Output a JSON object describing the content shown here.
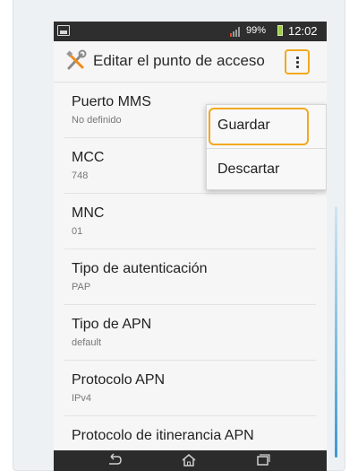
{
  "status_bar": {
    "battery_percent": "99%",
    "time": "12:02",
    "icons": [
      "picture-notification-icon",
      "signal-icon",
      "battery-icon"
    ]
  },
  "action_bar": {
    "title": "Editar el punto de acceso",
    "icon": "tools-icon",
    "overflow_icon": "more-vert-icon"
  },
  "settings": [
    {
      "title": "Puerto MMS",
      "value": "No definido"
    },
    {
      "title": "MCC",
      "value": "748"
    },
    {
      "title": "MNC",
      "value": "01"
    },
    {
      "title": "Tipo de autenticación",
      "value": "PAP"
    },
    {
      "title": "Tipo de APN",
      "value": "default"
    },
    {
      "title": "Protocolo APN",
      "value": "IPv4"
    },
    {
      "title": "Protocolo de itinerancia APN",
      "value": ""
    }
  ],
  "menu": {
    "items": [
      "Guardar",
      "Descartar"
    ],
    "highlighted": "Guardar"
  },
  "nav_bar": {
    "icons": [
      "back-icon",
      "home-icon",
      "recent-apps-icon"
    ]
  },
  "colors": {
    "highlight": "#f2a81d",
    "status_bar": "#2e2e2e",
    "background": "#f6f6f6"
  }
}
